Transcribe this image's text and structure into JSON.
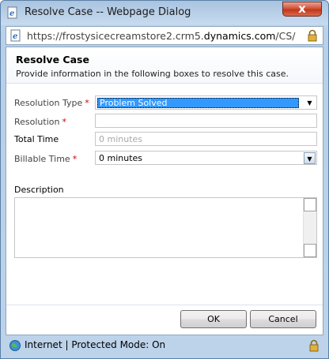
{
  "window": {
    "title": "Resolve Case -- Webpage Dialog",
    "close_symbol": "x",
    "icon": "ie-page-icon"
  },
  "address": {
    "url_prefix": "https://frostysicecreamstore2.crm5.",
    "url_domain": "dynamics.com",
    "url_suffix": "/CS/cases/dlg_"
  },
  "header": {
    "title": "Resolve Case",
    "subtitle": "Provide information in the following boxes to resolve this case."
  },
  "form": {
    "resolution_type": {
      "label": "Resolution Type",
      "required": "*",
      "value": "Problem Solved"
    },
    "resolution": {
      "label": "Resolution",
      "required": "*",
      "value": ""
    },
    "total_time": {
      "label": "Total Time",
      "value": "0 minutes"
    },
    "billable_time": {
      "label": "Billable Time",
      "required": "*",
      "value": "0 minutes"
    },
    "description": {
      "label": "Description",
      "value": ""
    }
  },
  "buttons": {
    "ok": "OK",
    "cancel": "Cancel"
  },
  "status": {
    "text": "Internet | Protected Mode: On"
  },
  "colors": {
    "required": "#cc0000",
    "selection": "#3399ff",
    "close": "#c2361b"
  }
}
